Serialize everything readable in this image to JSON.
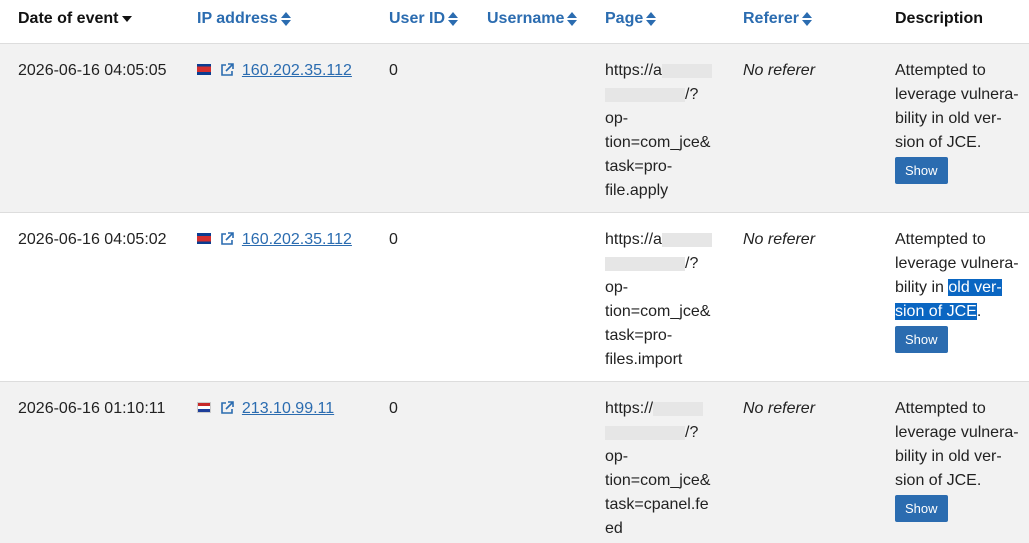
{
  "columns": {
    "date": "Date of event",
    "ip": "IP address",
    "uid": "User ID",
    "username": "Username",
    "page": "Page",
    "referer": "Referer",
    "description": "Description"
  },
  "rows": [
    {
      "date": "2026-06-16 04:05:05",
      "flag": "cambodia-flag",
      "ip": "160.202.35.112",
      "uid": "0",
      "username": "",
      "page_prefix": "https://a",
      "page_mid": "/?",
      "page_lines": [
        "op-",
        "tion=com_jce&",
        "task=pro-",
        "file.apply"
      ],
      "referer": "No referer",
      "desc_lines": [
        "Attempted to",
        "leverage vulnera-",
        "bility in old ver-",
        "sion of JCE."
      ],
      "button": "Show"
    },
    {
      "date": "2026-06-16 04:05:02",
      "flag": "cambodia-flag",
      "ip": "160.202.35.112",
      "uid": "0",
      "username": "",
      "page_prefix": "https://a",
      "page_mid": "/?",
      "page_lines": [
        "op-",
        "tion=com_jce&",
        "task=pro-",
        "files.import"
      ],
      "referer": "No referer",
      "desc_l1": "Attempted to",
      "desc_l2": "leverage vulnera-",
      "desc_l3a": "bility in ",
      "desc_l3b": "old ver-",
      "desc_l4a": "sion of JCE",
      "desc_l4b": ".",
      "button": "Show"
    },
    {
      "date": "2026-06-16 01:10:11",
      "flag": "netherlands-flag",
      "ip": "213.10.99.11",
      "uid": "0",
      "username": "",
      "page_prefix": "https://",
      "page_mid": "/?",
      "page_lines": [
        "op-",
        "tion=com_jce&",
        "task=cpanel.fe",
        "ed"
      ],
      "referer": "No referer",
      "desc_lines": [
        "Attempted to",
        "leverage vulnera-",
        "bility in old ver-",
        "sion of JCE."
      ],
      "button": "Show"
    }
  ],
  "colors": {
    "link": "#2b6cb0",
    "row_alt": "#f2f2f2",
    "highlight": "#0a66c2"
  }
}
